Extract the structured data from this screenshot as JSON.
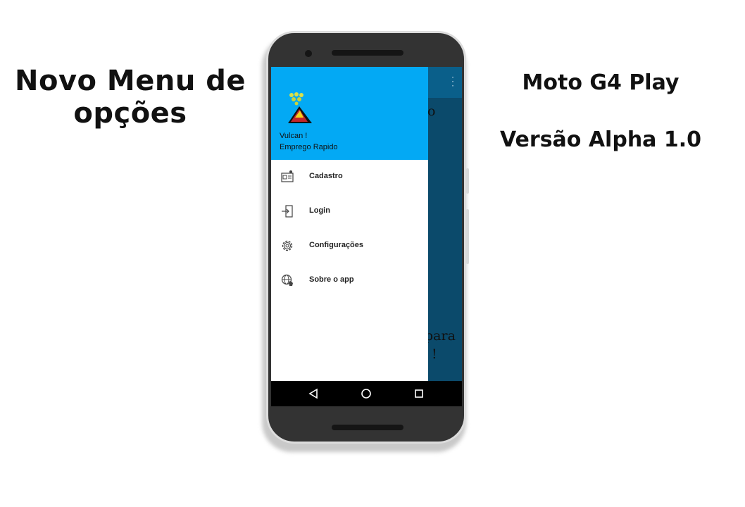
{
  "captions": {
    "left_title_line1": "Novo Menu de",
    "left_title_line2": "opções",
    "device": "Moto G4 Play",
    "version": "Versão Alpha 1.0"
  },
  "app": {
    "name": "Vulcan !",
    "subtitle": "Emprego Rapido",
    "background_fragments": [
      "o",
      "para",
      "!"
    ],
    "colors": {
      "header": "#03a9f4",
      "content_bg": "#0b4a6b",
      "toolbar": "#0a5f8a"
    }
  },
  "drawer": {
    "items": [
      {
        "label": "Cadastro",
        "icon": "id-card-icon"
      },
      {
        "label": "Login",
        "icon": "login-icon"
      },
      {
        "label": "Configurações",
        "icon": "gear-icon"
      },
      {
        "label": "Sobre o app",
        "icon": "globe-hand-icon"
      }
    ]
  },
  "navbar": {
    "buttons": [
      "back-icon",
      "home-icon",
      "recents-icon"
    ]
  }
}
